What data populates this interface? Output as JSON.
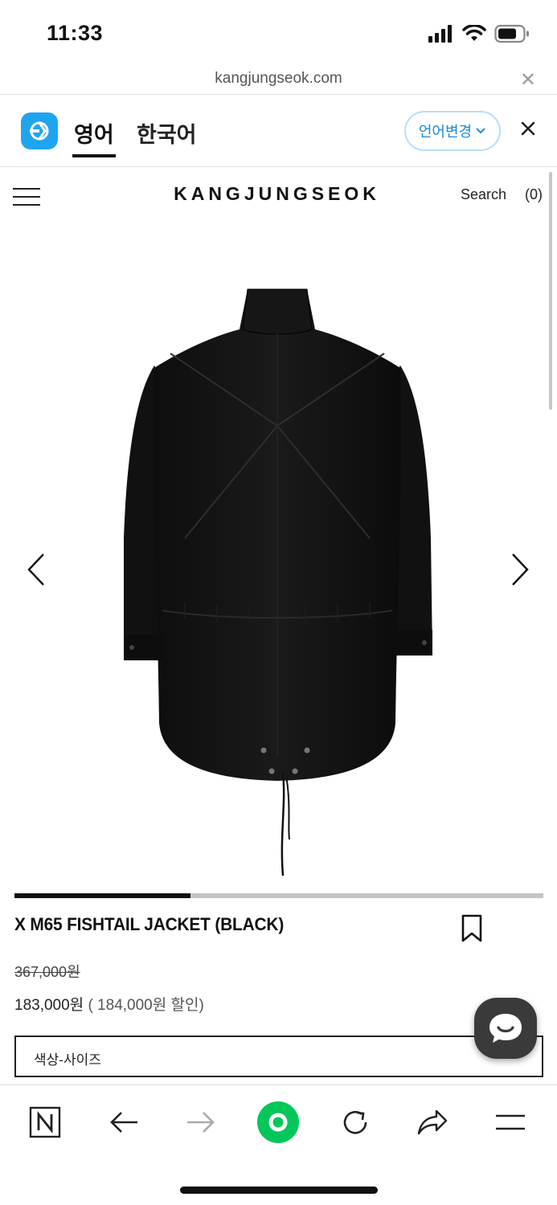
{
  "status_bar": {
    "time": "11:33"
  },
  "browser": {
    "url": "kangjungseok.com"
  },
  "translate_bar": {
    "tab_active": "영어",
    "tab_other": "한국어",
    "change_language": "언어변경"
  },
  "header": {
    "brand": "KANGJUNGSEOK",
    "search": "Search",
    "cart_count": "(0)"
  },
  "gallery": {
    "progress": 0.333
  },
  "product": {
    "name": "X M65 FISHTAIL JACKET (BLACK)",
    "original_price": "367,000원",
    "sale_price": "183,000원",
    "discount": "( 184,000원 할인)",
    "option_placeholder": "색상-사이즈"
  },
  "colors": {
    "accent_blue": "#1b8ad8",
    "papago_blue": "#1fa5f0",
    "naver_green": "#03c75a",
    "chat_fab": "#3a3a3a"
  },
  "toolbar": {
    "icons": [
      "naver-n-icon",
      "back-arrow-icon",
      "forward-arrow-icon",
      "green-dot-icon",
      "refresh-icon",
      "share-icon",
      "menu-icon"
    ]
  }
}
